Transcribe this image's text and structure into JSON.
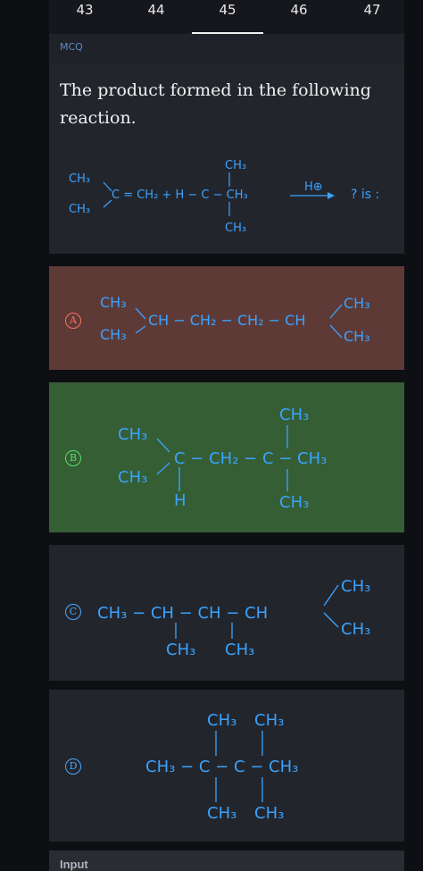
{
  "tabs": [
    "43",
    "44",
    "45",
    "46",
    "47"
  ],
  "active_tab": "45",
  "header": {
    "label": "MCQ"
  },
  "question": {
    "text": "The product formed in the following reaction.",
    "reagent_top_ch3": "CH3",
    "reagent_left_ch3a": "CH3",
    "reagent_left_ch3b": "CH3",
    "reagent_eq": "C = CH2 + H − C − CH3",
    "reagent_bottom_ch3": "CH3",
    "catalyst": "H⊕",
    "tail": "? is :"
  },
  "options": [
    {
      "letter": "A",
      "status": "incorrect",
      "color": "#5e3a37"
    },
    {
      "letter": "B",
      "status": "correct",
      "color": "#355e35"
    },
    {
      "letter": "C",
      "status": "neutral",
      "color": "#23252c"
    },
    {
      "letter": "D",
      "status": "neutral",
      "color": "#23252c"
    }
  ],
  "input": {
    "label": "Input"
  },
  "colors": {
    "accent": "#3aa3ff",
    "wrong": "#ff6f61",
    "right": "#58e06a"
  }
}
